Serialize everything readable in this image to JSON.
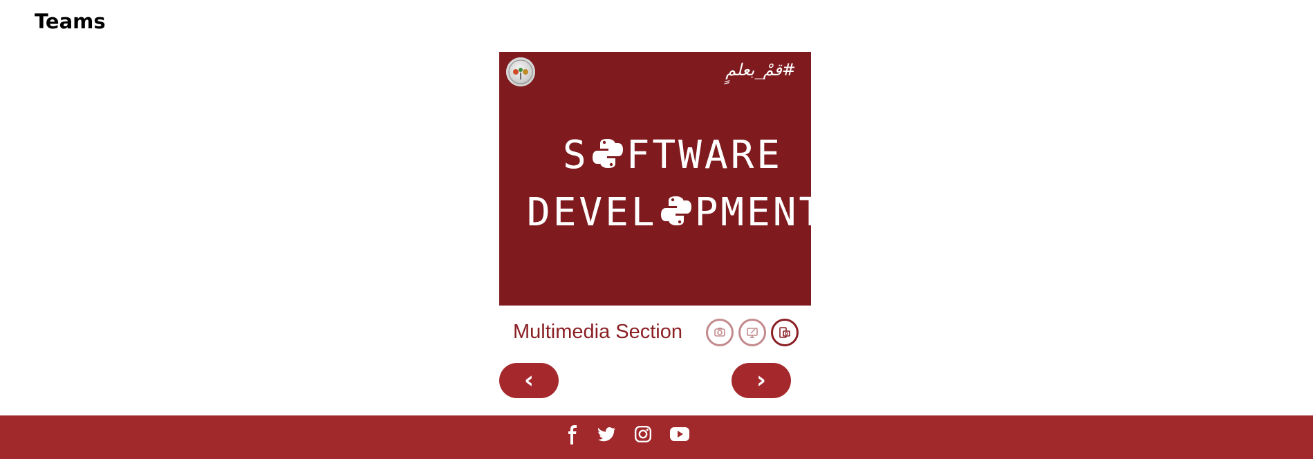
{
  "page": {
    "title": "Teams"
  },
  "poster": {
    "hashtag": "#قمْ_بعلمٍ",
    "line1_before": "S",
    "line1_after": "FTWARE",
    "line2_before": "DEVEL",
    "line2_after": "PMENT;",
    "logo_icon": "club-logo-icon",
    "python_icon": "python-logo-icon"
  },
  "section": {
    "label": "Multimedia Section",
    "icons": [
      {
        "name": "camera-team-icon",
        "active": false
      },
      {
        "name": "design-team-icon",
        "active": false
      },
      {
        "name": "software-team-icon",
        "active": true
      }
    ]
  },
  "navigation": {
    "prev_label": "‹",
    "next_label": "›"
  },
  "footer": {
    "social": [
      "facebook-icon",
      "twitter-icon",
      "instagram-icon",
      "youtube-icon"
    ]
  },
  "colors": {
    "brand": "#a1282b",
    "poster_bg": "#7f1a1e",
    "section_text": "#8a1f24",
    "inactive_ring": "#c38a8d"
  }
}
